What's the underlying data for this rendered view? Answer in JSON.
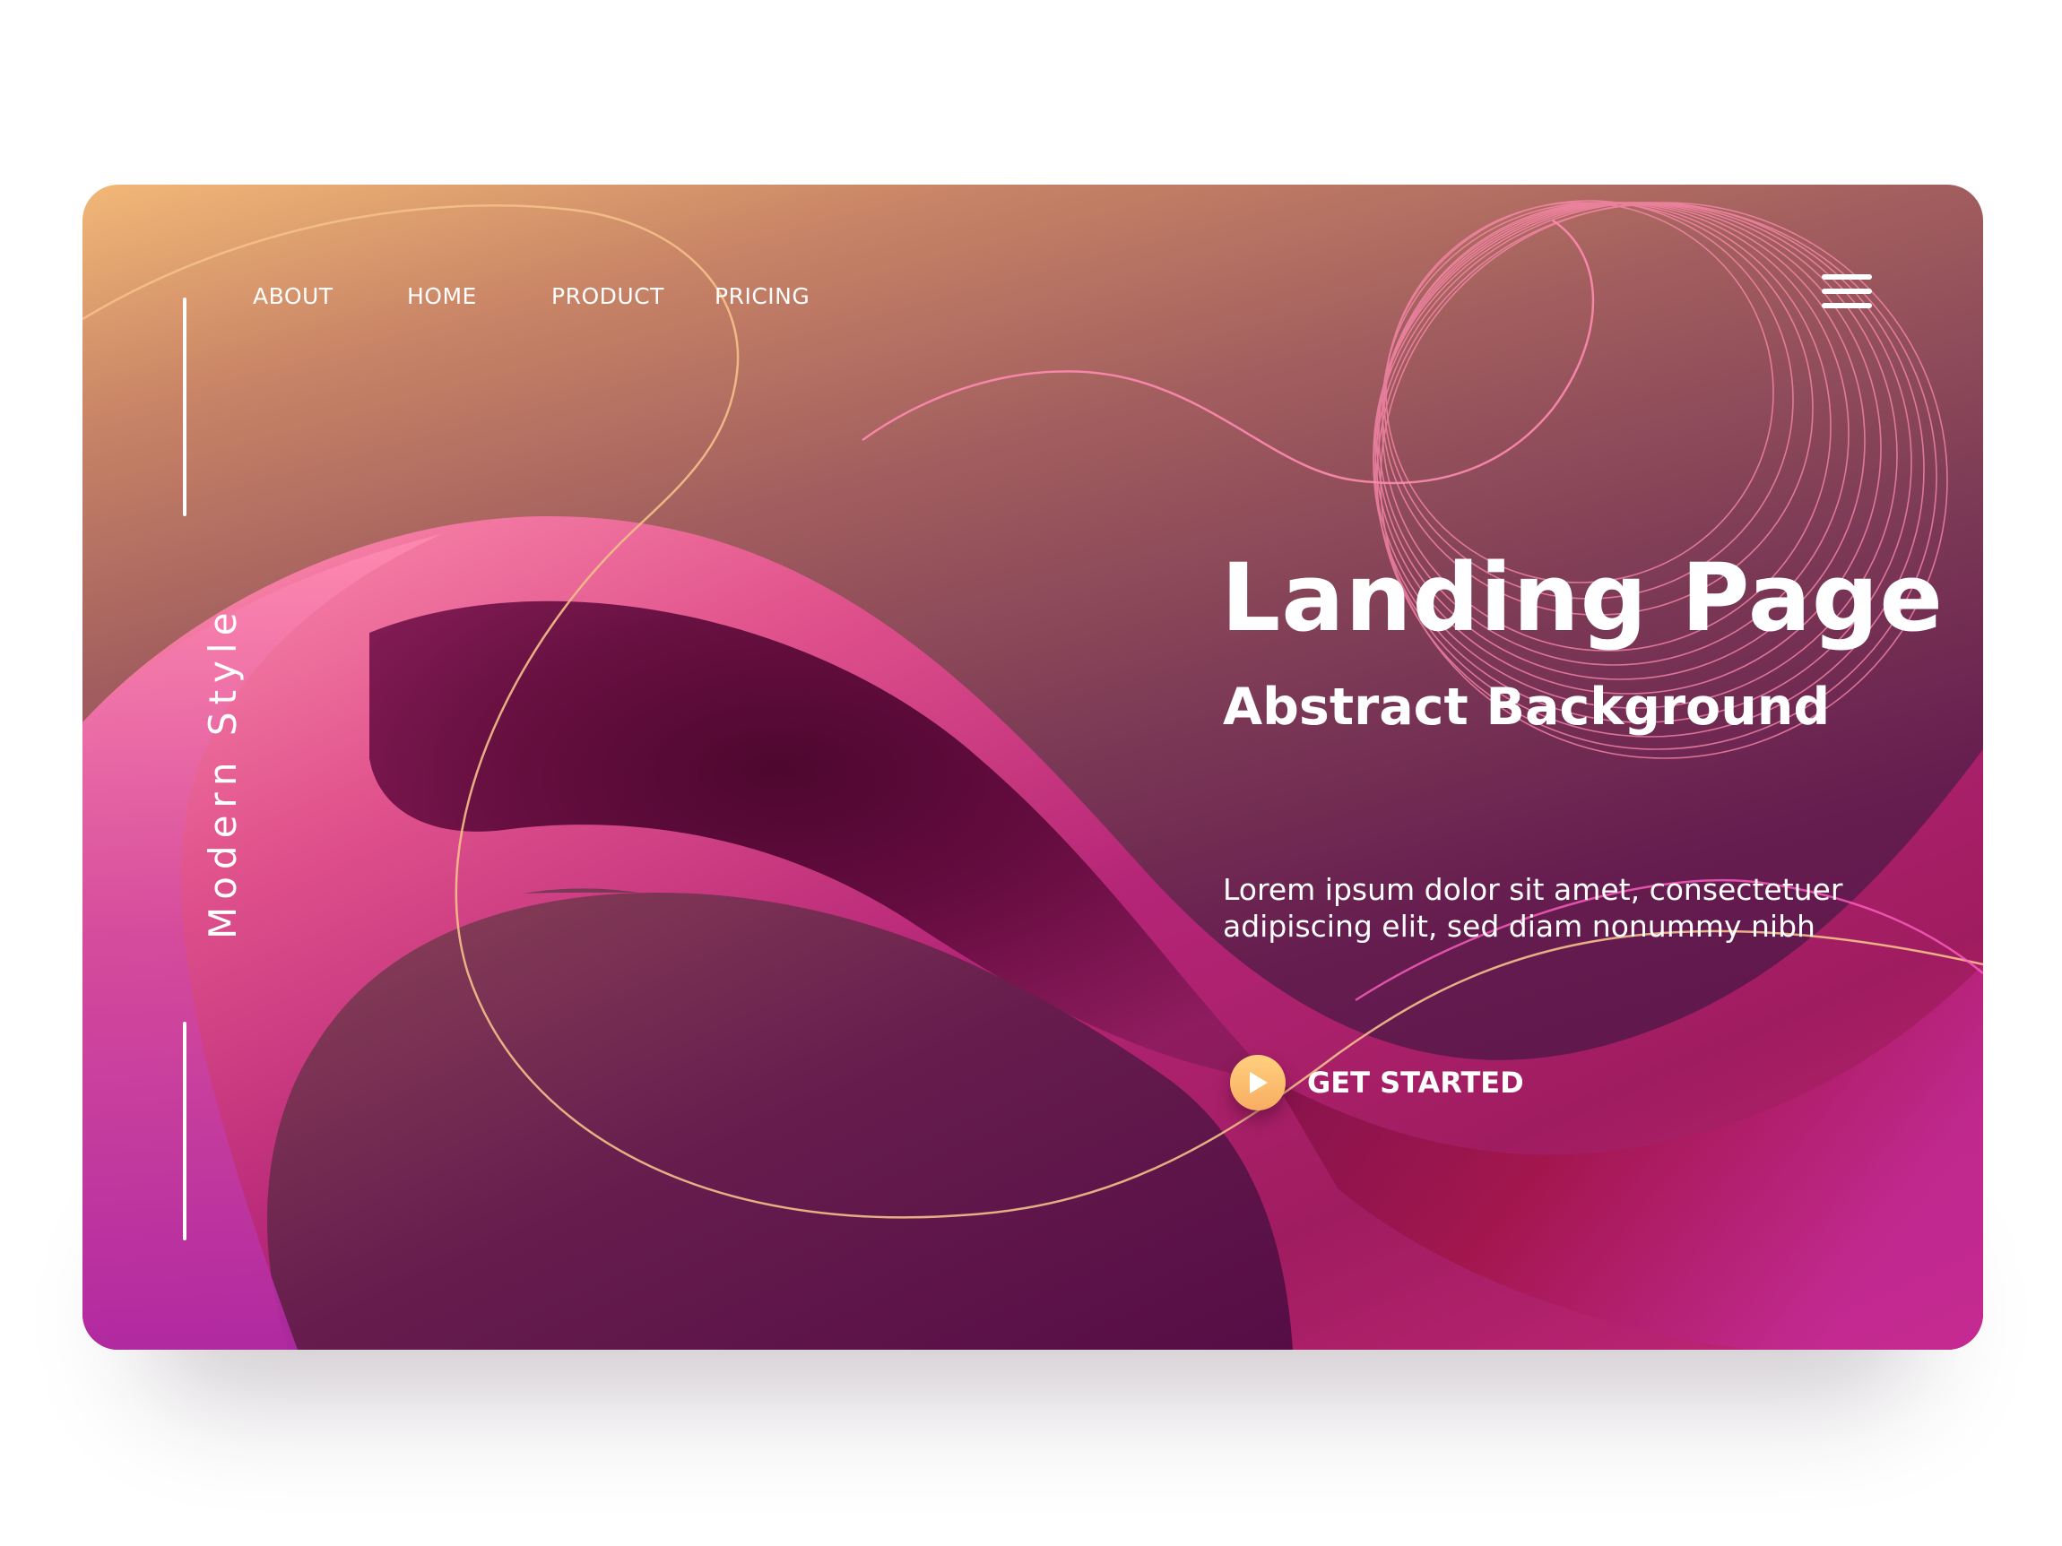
{
  "nav": {
    "items": [
      {
        "label": "ABOUT"
      },
      {
        "label": "HOME"
      },
      {
        "label": "PRODUCT"
      },
      {
        "label": "PRICING"
      }
    ]
  },
  "side": {
    "vertical_label": "Modern Style"
  },
  "hero": {
    "title": "Landing Page",
    "subtitle": "Abstract Background",
    "body": "Lorem ipsum dolor sit amet, consectetuer adipiscing elit, sed diam nonummy nibh",
    "cta_label": "GET STARTED"
  },
  "icons": {
    "menu": "hamburger-menu-icon",
    "cta": "play-icon"
  },
  "colors": {
    "gradient_top": "#f2b877",
    "gradient_bottom": "#560d45",
    "accent_pink": "#ff7fa6",
    "accent_magenta": "#c02a9e",
    "cta_orange": "#f8ad62",
    "text": "#ffffff"
  }
}
